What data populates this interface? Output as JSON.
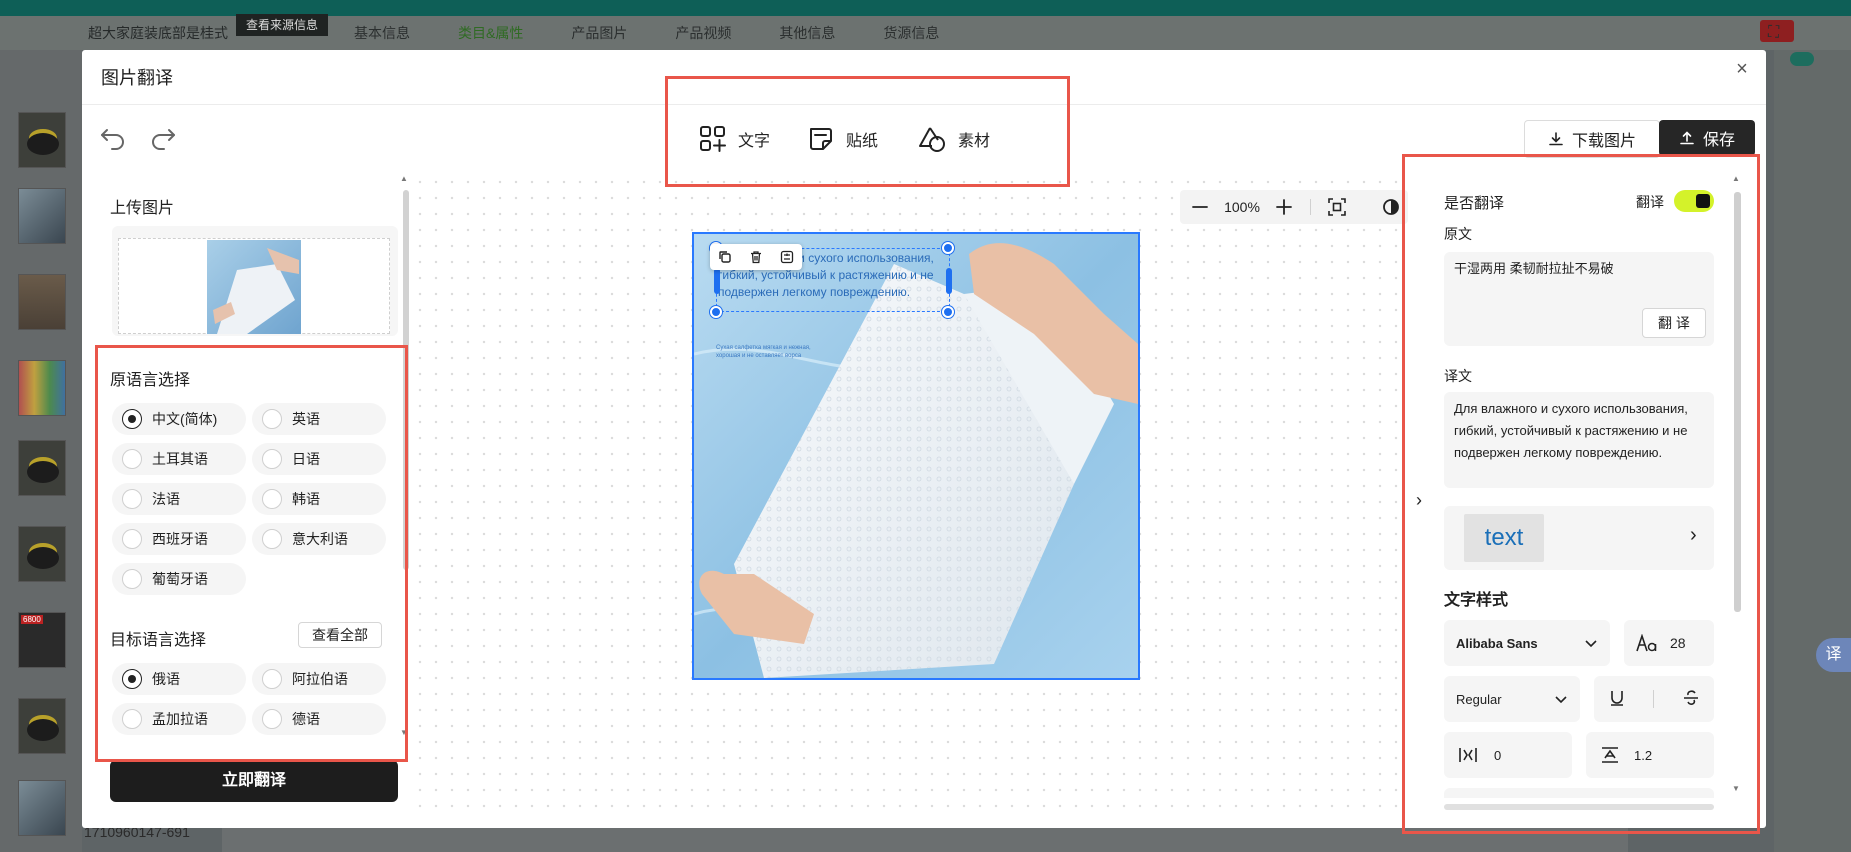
{
  "background": {
    "title": "超大家庭装底部是桂式",
    "source_badge": "查看来源信息",
    "tabs": [
      "基本信息",
      "类目&属性",
      "产品图片",
      "产品视频",
      "其他信息",
      "货源信息"
    ],
    "bottom_text": "1710960147-691",
    "translate_pill": "译"
  },
  "dialog": {
    "title": "图片翻译",
    "close": "×"
  },
  "toolbar": {
    "items": [
      {
        "label": "文字",
        "icon": "add-text-grid-icon"
      },
      {
        "label": "贴纸",
        "icon": "sticker-icon"
      },
      {
        "label": "素材",
        "icon": "material-shapes-icon"
      }
    ],
    "download_label": "下载图片",
    "save_label": "保存"
  },
  "left_panel": {
    "upload_title": "上传图片",
    "source_lang_title": "原语言选择",
    "source_langs": [
      {
        "label": "中文(简体)",
        "checked": true
      },
      {
        "label": "英语",
        "checked": false
      },
      {
        "label": "土耳其语",
        "checked": false
      },
      {
        "label": "日语",
        "checked": false
      },
      {
        "label": "法语",
        "checked": false
      },
      {
        "label": "韩语",
        "checked": false
      },
      {
        "label": "西班牙语",
        "checked": false
      },
      {
        "label": "意大利语",
        "checked": false
      },
      {
        "label": "葡萄牙语",
        "checked": false
      }
    ],
    "target_lang_title": "目标语言选择",
    "view_all_label": "查看全部",
    "target_langs": [
      {
        "label": "俄语",
        "checked": true
      },
      {
        "label": "阿拉伯语",
        "checked": false
      },
      {
        "label": "孟加拉语",
        "checked": false
      },
      {
        "label": "德语",
        "checked": false
      }
    ],
    "translate_now_label": "立即翻译"
  },
  "canvas": {
    "zoom": "100%",
    "image_text": "Для влажного и сухого использования, гибкий, устойчивый к растяжению и не подвержен легкому повреждению.",
    "image_small_text": "Сухая салфетка мягкая и нежная, хорошая и не оставляет ворса"
  },
  "right_panel": {
    "translate_toggle_title": "是否翻译",
    "translate_toggle_label": "翻译",
    "translate_on": true,
    "original_label": "原文",
    "original_text": "干湿两用 柔韧耐拉扯不易破",
    "translate_button": "翻 译",
    "translation_label": "译文",
    "translation_text": "Для влажного и сухого использования, гибкий, устойчивый к растяжению и не подвержен легкому повреждению.",
    "style_preview": "text",
    "font_style_title": "文字样式",
    "font_family": "Alibaba Sans",
    "font_size": "28",
    "font_weight": "Regular",
    "letter_spacing": "0",
    "line_height": "1.2"
  },
  "colors": {
    "annotation_red": "#e9564a",
    "selection_blue": "#2979ff",
    "toggle_on": "#d4f22a",
    "dark_button": "#262626"
  }
}
